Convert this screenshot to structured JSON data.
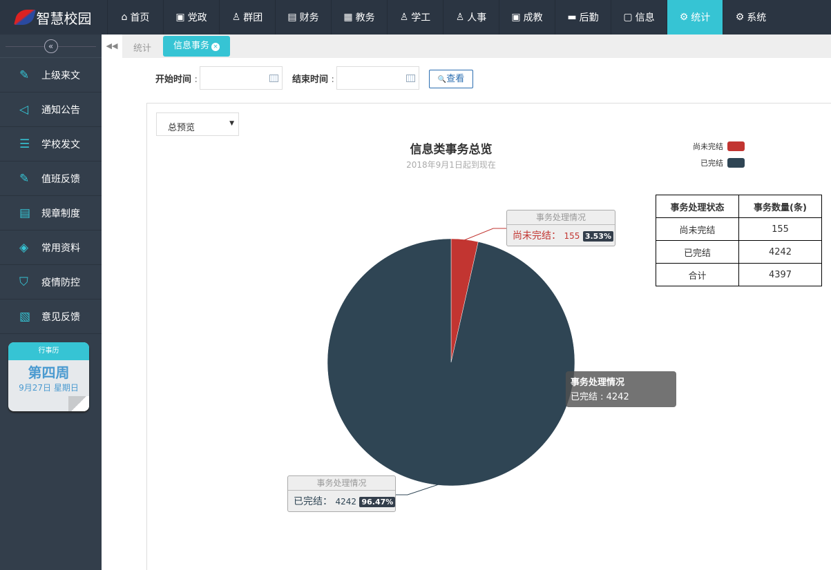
{
  "app": {
    "title": "智慧校园"
  },
  "nav": [
    {
      "label": "首页",
      "icon": "⌂"
    },
    {
      "label": "党政",
      "icon": "▣"
    },
    {
      "label": "群团",
      "icon": "♙"
    },
    {
      "label": "财务",
      "icon": "▤"
    },
    {
      "label": "教务",
      "icon": "▦"
    },
    {
      "label": "学工",
      "icon": "♙"
    },
    {
      "label": "人事",
      "icon": "♙"
    },
    {
      "label": "成教",
      "icon": "▣"
    },
    {
      "label": "后勤",
      "icon": "▬"
    },
    {
      "label": "信息",
      "icon": "▢"
    },
    {
      "label": "统计",
      "icon": "⚙"
    },
    {
      "label": "系统",
      "icon": "⚙"
    }
  ],
  "sidebar": {
    "collapse": "«",
    "items": [
      {
        "label": "上级来文",
        "icon": "✎"
      },
      {
        "label": "通知公告",
        "icon": "◁"
      },
      {
        "label": "学校发文",
        "icon": "☰"
      },
      {
        "label": "值班反馈",
        "icon": "✎"
      },
      {
        "label": "规章制度",
        "icon": "▤"
      },
      {
        "label": "常用资料",
        "icon": "◈"
      },
      {
        "label": "疫情防控",
        "icon": "⛉"
      },
      {
        "label": "意见反馈",
        "icon": "▧"
      }
    ]
  },
  "calendar": {
    "header": "行事历",
    "week": "第四周",
    "date": "9月27日 星期日"
  },
  "tabs": {
    "back": "◀◀",
    "parent": "统计",
    "active": "信息事务",
    "close": "×"
  },
  "filters": {
    "start_label": "开始时间",
    "end_label": "结束时间",
    "colon": ":",
    "start_value": "",
    "end_value": "",
    "search": "查看",
    "search_icon": "🔍"
  },
  "select": {
    "value": "总预览",
    "arrow": "▼"
  },
  "chart_data": {
    "type": "pie",
    "title": "信息类事务总览",
    "subtitle": "2018年9月1日起到现在",
    "series_name": "事务处理情况",
    "legend_position": "top-right",
    "slices": [
      {
        "name": "尚未完结",
        "value": 155,
        "percent": "3.53%",
        "color": "#c23531"
      },
      {
        "name": "已完结",
        "value": 4242,
        "percent": "96.47%",
        "color": "#2f4554"
      }
    ],
    "tooltip": {
      "title": "事务处理情况",
      "text": "已完结 : 4242 (96.47%)"
    }
  },
  "table": {
    "headers": [
      "事务处理状态",
      "事务数量(条)"
    ],
    "rows": [
      [
        "尚未完结",
        "155"
      ],
      [
        "已完结",
        "4242"
      ],
      [
        "合计",
        "4397"
      ]
    ]
  }
}
